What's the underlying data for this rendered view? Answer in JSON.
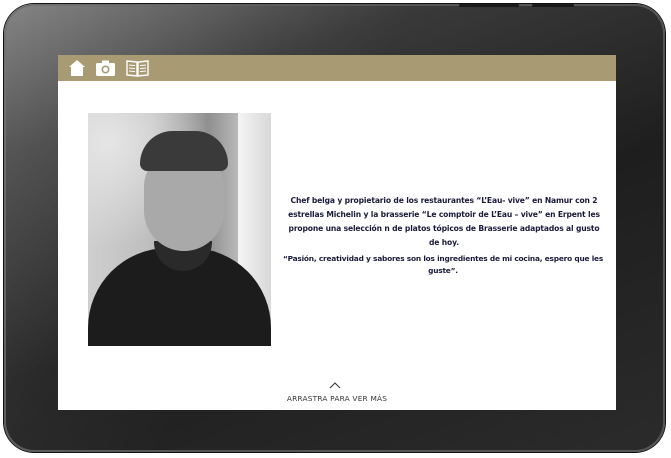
{
  "toolbar": {
    "background_color": "#a89a73",
    "icons": [
      "home-icon",
      "camera-icon",
      "book-icon"
    ]
  },
  "profile": {
    "photo": "chef-portrait",
    "bio": "Chef belga y propietario de los restaurantes “L’Eau- vive” en Namur con 2 estrellas Michelin y la brasserie “Le comptoir de L’Eau – vive” en Erpent les propone una selección n de platos tópicos de Brasserie adaptados al gusto de hoy.",
    "quote": "“Pasión, creatividad y sabores son los ingredientes de mi cocina, espero que les guste”."
  },
  "footer": {
    "arrow_icon": "chevron-up-icon",
    "hint": "ARRASTRA PARA VER MÁS"
  },
  "colors": {
    "text": "#1a1a3a",
    "bezel": "#1e1e1e"
  }
}
